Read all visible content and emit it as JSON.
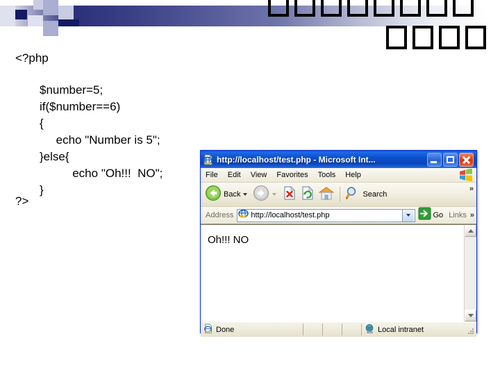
{
  "slide": {
    "php_open_tag": "<?php",
    "php_close_tag": "?>",
    "code_lines": [
      "$number=5;",
      "if($number==6)",
      "{",
      "     echo \"Number is 5\";",
      "}else{",
      "          echo \"Oh!!!  NO\";",
      "}"
    ],
    "header_glyph_rows": [
      {
        "count": 8,
        "glyph": "□"
      },
      {
        "count": 4,
        "glyph": "□"
      }
    ],
    "accent_colors": {
      "navy": "#131a63",
      "gradient_start": "#2b2f7a",
      "lavender": "#a9aed2"
    }
  },
  "browser": {
    "title": "http://localhost/test.php - Microsoft Int...",
    "title_icon": "ie-page-icon",
    "window_buttons": [
      {
        "name": "minimize",
        "label": "Minimize"
      },
      {
        "name": "maximize",
        "label": "Maximize"
      },
      {
        "name": "close",
        "label": "Close"
      }
    ],
    "menu": [
      "File",
      "Edit",
      "View",
      "Favorites",
      "Tools",
      "Help"
    ],
    "menu_logo": "windows-flag-logo",
    "toolbar": {
      "back_label": "Back",
      "search_label": "Search",
      "overflow_chevron": "»",
      "buttons": [
        {
          "name": "back",
          "icon": "back-arrow-icon",
          "label": "Back",
          "enabled": true
        },
        {
          "name": "forward",
          "icon": "forward-arrow-icon",
          "label": "",
          "enabled": false
        },
        {
          "name": "stop",
          "icon": "stop-icon",
          "label": ""
        },
        {
          "name": "refresh",
          "icon": "refresh-icon",
          "label": ""
        },
        {
          "name": "home",
          "icon": "home-icon",
          "label": ""
        },
        {
          "name": "search",
          "icon": "search-icon",
          "label": "Search"
        }
      ]
    },
    "address": {
      "label": "Address",
      "url": "http://localhost/test.php",
      "placeholder": "http://",
      "go_label": "Go",
      "links_label": "Links",
      "overflow_chevron": "»"
    },
    "page": {
      "body_text": "Oh!!! NO"
    },
    "status": {
      "done_text": "Done",
      "zone_text": "Local intranet",
      "zone_icon": "globe-icon",
      "done_icon": "ie-page-icon"
    },
    "colors": {
      "title_bar": "#0a4fc8",
      "chrome": "#ece9d8",
      "border": "#0831d9",
      "close_button": "#d4350f"
    }
  }
}
